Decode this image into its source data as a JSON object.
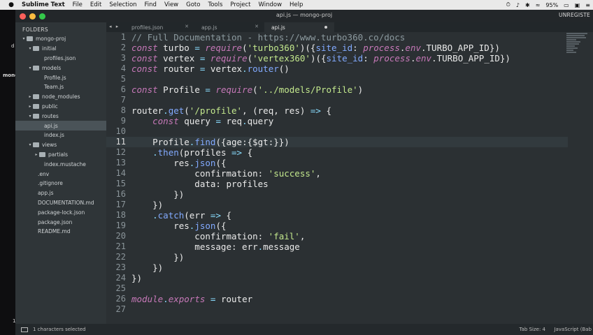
{
  "menubar": {
    "apple": "",
    "app": "Sublime Text",
    "items": [
      "File",
      "Edit",
      "Selection",
      "Find",
      "View",
      "Goto",
      "Tools",
      "Project",
      "Window",
      "Help"
    ],
    "battery": "95%"
  },
  "desktop": {
    "label1": "mono",
    "label2": "d",
    "label3": "1"
  },
  "window": {
    "title": "api.js — mongo-proj",
    "unregistered": "UNREGISTE"
  },
  "sidebar": {
    "header": "FOLDERS",
    "items": [
      {
        "label": "mongo-proj",
        "depth": 0,
        "type": "folder",
        "open": true
      },
      {
        "label": "initial",
        "depth": 1,
        "type": "folder",
        "open": true
      },
      {
        "label": "profiles.json",
        "depth": 2,
        "type": "file"
      },
      {
        "label": "models",
        "depth": 1,
        "type": "folder",
        "open": true
      },
      {
        "label": "Profile.js",
        "depth": 2,
        "type": "file"
      },
      {
        "label": "Team.js",
        "depth": 2,
        "type": "file"
      },
      {
        "label": "node_modules",
        "depth": 1,
        "type": "folder",
        "open": false
      },
      {
        "label": "public",
        "depth": 1,
        "type": "folder",
        "open": false
      },
      {
        "label": "routes",
        "depth": 1,
        "type": "folder",
        "open": true
      },
      {
        "label": "api.js",
        "depth": 2,
        "type": "file",
        "selected": true
      },
      {
        "label": "index.js",
        "depth": 2,
        "type": "file"
      },
      {
        "label": "views",
        "depth": 1,
        "type": "folder",
        "open": true
      },
      {
        "label": "partials",
        "depth": 2,
        "type": "folder",
        "open": false
      },
      {
        "label": "index.mustache",
        "depth": 2,
        "type": "file"
      },
      {
        "label": ".env",
        "depth": 1,
        "type": "file"
      },
      {
        "label": ".gitignore",
        "depth": 1,
        "type": "file"
      },
      {
        "label": "app.js",
        "depth": 1,
        "type": "file"
      },
      {
        "label": "DOCUMENTATION.md",
        "depth": 1,
        "type": "file"
      },
      {
        "label": "package-lock.json",
        "depth": 1,
        "type": "file"
      },
      {
        "label": "package.json",
        "depth": 1,
        "type": "file"
      },
      {
        "label": "README.md",
        "depth": 1,
        "type": "file"
      }
    ]
  },
  "tabs": {
    "nav": "◂ ▸",
    "items": [
      {
        "label": "profiles.json",
        "active": false
      },
      {
        "label": "app.js",
        "active": false
      },
      {
        "label": "api.js",
        "active": true
      }
    ]
  },
  "editor": {
    "current_line": 11,
    "lines": [
      {
        "n": "1",
        "tokens": [
          [
            "cm",
            "// Full Documentation - https://www.turbo360.co/docs"
          ]
        ]
      },
      {
        "n": "2",
        "tokens": [
          [
            "kw",
            "const"
          ],
          [
            "var",
            " turbo "
          ],
          [
            "op",
            "="
          ],
          [
            "var",
            " "
          ],
          [
            "kw",
            "require"
          ],
          [
            "var",
            "("
          ],
          [
            "str",
            "'turbo360'"
          ],
          [
            "var",
            ")({"
          ],
          [
            "fn",
            "site_id"
          ],
          [
            "var",
            ": "
          ],
          [
            "kw",
            "process"
          ],
          [
            "var",
            "."
          ],
          [
            "kw",
            "env"
          ],
          [
            "var",
            ".TURBO_APP_ID})"
          ]
        ]
      },
      {
        "n": "3",
        "tokens": [
          [
            "kw",
            "const"
          ],
          [
            "var",
            " vertex "
          ],
          [
            "op",
            "="
          ],
          [
            "var",
            " "
          ],
          [
            "kw",
            "require"
          ],
          [
            "var",
            "("
          ],
          [
            "str",
            "'vertex360'"
          ],
          [
            "var",
            ")({"
          ],
          [
            "fn",
            "site_id"
          ],
          [
            "var",
            ": "
          ],
          [
            "kw",
            "process"
          ],
          [
            "var",
            "."
          ],
          [
            "kw",
            "env"
          ],
          [
            "var",
            ".TURBO_APP_ID})"
          ]
        ]
      },
      {
        "n": "4",
        "tokens": [
          [
            "kw",
            "const"
          ],
          [
            "var",
            " router "
          ],
          [
            "op",
            "="
          ],
          [
            "var",
            " vertex"
          ],
          [
            "op",
            "."
          ],
          [
            "fn",
            "router"
          ],
          [
            "var",
            "()"
          ]
        ]
      },
      {
        "n": "5",
        "tokens": []
      },
      {
        "n": "6",
        "tokens": [
          [
            "kw",
            "const"
          ],
          [
            "var",
            " Profile "
          ],
          [
            "op",
            "="
          ],
          [
            "var",
            " "
          ],
          [
            "kw",
            "require"
          ],
          [
            "var",
            "("
          ],
          [
            "str",
            "'../models/Profile'"
          ],
          [
            "var",
            ")"
          ]
        ]
      },
      {
        "n": "7",
        "tokens": []
      },
      {
        "n": "8",
        "tokens": [
          [
            "var",
            "router"
          ],
          [
            "op",
            "."
          ],
          [
            "fn",
            "get"
          ],
          [
            "var",
            "("
          ],
          [
            "str",
            "'/profile'"
          ],
          [
            "var",
            ", (req, res) "
          ],
          [
            "op",
            "=>"
          ],
          [
            "var",
            " {"
          ]
        ]
      },
      {
        "n": "9",
        "tokens": [
          [
            "var",
            "    "
          ],
          [
            "kw",
            "const"
          ],
          [
            "var",
            " query "
          ],
          [
            "op",
            "="
          ],
          [
            "var",
            " req"
          ],
          [
            "op",
            "."
          ],
          [
            "var",
            "query"
          ]
        ]
      },
      {
        "n": "10",
        "tokens": []
      },
      {
        "n": "11",
        "tokens": [
          [
            "var",
            "    Profile"
          ],
          [
            "op",
            "."
          ],
          [
            "fn",
            "find"
          ],
          [
            "var",
            "({age:{$gt:}})"
          ]
        ]
      },
      {
        "n": "12",
        "tokens": [
          [
            "var",
            "    "
          ],
          [
            "op",
            "."
          ],
          [
            "fn",
            "then"
          ],
          [
            "var",
            "(profiles "
          ],
          [
            "op",
            "=>"
          ],
          [
            "var",
            " {"
          ]
        ]
      },
      {
        "n": "13",
        "tokens": [
          [
            "var",
            "        res"
          ],
          [
            "op",
            "."
          ],
          [
            "fn",
            "json"
          ],
          [
            "var",
            "({"
          ]
        ]
      },
      {
        "n": "14",
        "tokens": [
          [
            "var",
            "            confirmation: "
          ],
          [
            "str",
            "'success'"
          ],
          [
            "var",
            ","
          ]
        ]
      },
      {
        "n": "15",
        "tokens": [
          [
            "var",
            "            data: profiles"
          ]
        ]
      },
      {
        "n": "16",
        "tokens": [
          [
            "var",
            "        })"
          ]
        ]
      },
      {
        "n": "17",
        "tokens": [
          [
            "var",
            "    })"
          ]
        ]
      },
      {
        "n": "18",
        "tokens": [
          [
            "var",
            "    "
          ],
          [
            "op",
            "."
          ],
          [
            "fn",
            "catch"
          ],
          [
            "var",
            "(err "
          ],
          [
            "op",
            "=>"
          ],
          [
            "var",
            " {"
          ]
        ]
      },
      {
        "n": "19",
        "tokens": [
          [
            "var",
            "        res"
          ],
          [
            "op",
            "."
          ],
          [
            "fn",
            "json"
          ],
          [
            "var",
            "({"
          ]
        ]
      },
      {
        "n": "20",
        "tokens": [
          [
            "var",
            "            confirmation: "
          ],
          [
            "str",
            "'fail'"
          ],
          [
            "var",
            ","
          ]
        ]
      },
      {
        "n": "21",
        "tokens": [
          [
            "var",
            "            message: err"
          ],
          [
            "op",
            "."
          ],
          [
            "var",
            "message"
          ]
        ]
      },
      {
        "n": "22",
        "tokens": [
          [
            "var",
            "        })"
          ]
        ]
      },
      {
        "n": "23",
        "tokens": [
          [
            "var",
            "    })"
          ]
        ]
      },
      {
        "n": "24",
        "tokens": [
          [
            "var",
            "})"
          ]
        ]
      },
      {
        "n": "25",
        "tokens": []
      },
      {
        "n": "26",
        "tokens": [
          [
            "kw",
            "module"
          ],
          [
            "op",
            "."
          ],
          [
            "kw",
            "exports"
          ],
          [
            "var",
            " "
          ],
          [
            "op",
            "="
          ],
          [
            "var",
            " router"
          ]
        ]
      },
      {
        "n": "27",
        "tokens": []
      }
    ]
  },
  "status": {
    "selection": "1 characters selected",
    "tab_size": "Tab Size: 4",
    "syntax": "JavaScript (Bab"
  },
  "colors": {
    "keyword": "#c678b8",
    "string": "#c3e88d",
    "function": "#82aaff",
    "operator": "#89ddff",
    "comment": "#8c9a9f"
  }
}
